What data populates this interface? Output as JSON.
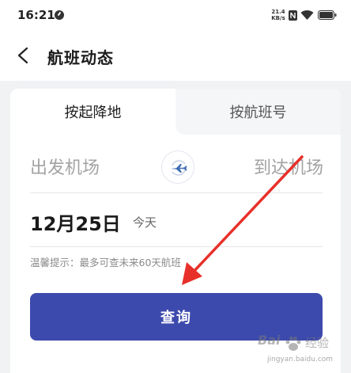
{
  "status_bar": {
    "time": "16:21",
    "net_speed_value": "21.4",
    "net_speed_unit": "KB/s",
    "icons": [
      "notification-dot-icon",
      "nfc-icon",
      "wifi-icon",
      "battery-icon"
    ]
  },
  "header": {
    "title": "航班动态",
    "back_icon": "chevron-left-icon"
  },
  "tabs": [
    {
      "label": "按起降地",
      "active": true
    },
    {
      "label": "按航班号",
      "active": false
    }
  ],
  "route": {
    "departure_placeholder": "出发机场",
    "arrival_placeholder": "到达机场",
    "swap_icon": "airplane-swap-icon"
  },
  "date": {
    "value": "12月25日",
    "day_label": "今天"
  },
  "tip": "温馨提示：最多可查未来60天航班",
  "search_button_label": "查询",
  "annotation": {
    "type": "red-arrow",
    "color": "#e8302a"
  },
  "watermark": {
    "logo": "Bai",
    "cn": "经验",
    "url": "jingyan.baidu.com"
  },
  "colors": {
    "primary": "#3d4aad",
    "background": "#f1f2f4",
    "placeholder": "#a3a3a3"
  }
}
